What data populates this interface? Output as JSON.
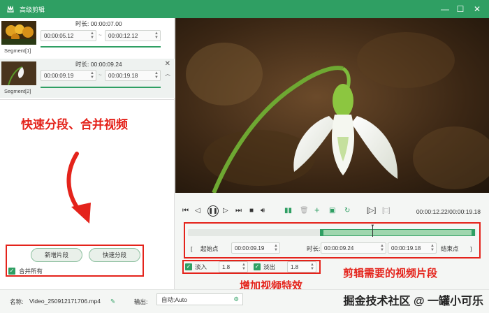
{
  "window": {
    "title": "高级剪辑",
    "minimize": "—",
    "maximize": "☐",
    "close": "✕"
  },
  "segments": [
    {
      "label": "Segment[1]",
      "duration_label": "时长:",
      "duration": "00:00:07.00",
      "start": "00:00:05.12",
      "end": "00:00:12.12"
    },
    {
      "label": "Segment[2]",
      "duration_label": "时长:",
      "duration": "00:00:09.24",
      "start": "00:00:09.19",
      "end": "00:00:19.18"
    }
  ],
  "annotations": {
    "left_title": "快速分段、合并视频",
    "timeline_note": "剪辑需要的视频片段",
    "effects_note": "增加视频特效"
  },
  "left_buttons": {
    "add_segment": "新增片段",
    "fast_split": "快速分段",
    "merge_all": "合并所有"
  },
  "player": {
    "time": "00:00:12.22/00:00:19.18",
    "progress": 0.64
  },
  "timeline": {
    "selection_start": 0.457,
    "selection_end": 1.0,
    "playhead": 0.64,
    "start_point_label": "起始点",
    "start_value": "00:00:09.19",
    "duration_label": "时长:",
    "duration_value": "00:00:09.24",
    "end_value": "00:00:19.18",
    "end_point_label": "结束点"
  },
  "effects": {
    "fade_in_label": "淡入",
    "fade_in_value": "1.8",
    "fade_out_label": "淡出",
    "fade_out_value": "1.8"
  },
  "bottom": {
    "name_label": "名称:",
    "file_name": "Video_250912171706.mp4",
    "output_label": "输出:",
    "output_value": "自动;Auto"
  },
  "watermark": "掘金技术社区 @ 一罐小可乐",
  "colors": {
    "accent": "#2f9f63",
    "annotation": "#e4231b"
  }
}
